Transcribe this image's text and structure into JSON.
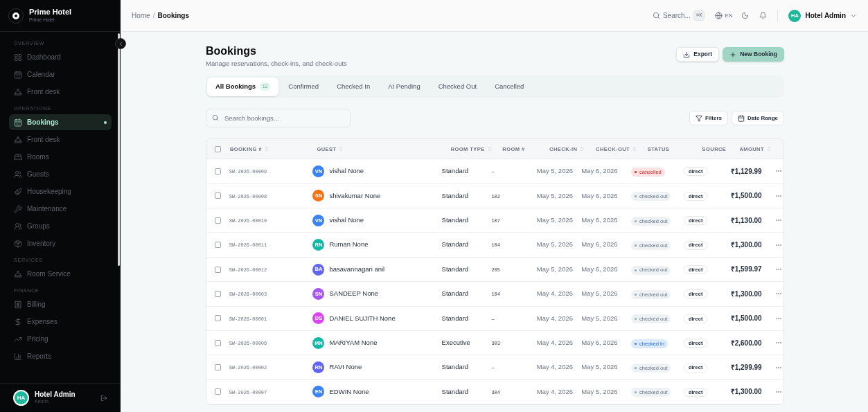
{
  "brand": {
    "name": "Prime Hotel",
    "subtitle": "Prime Hotel"
  },
  "sidebar": {
    "sections": [
      {
        "title": "OVERVIEW",
        "items": [
          {
            "label": "Dashboard",
            "selected": false
          },
          {
            "label": "Calendar",
            "selected": false
          },
          {
            "label": "Front desk",
            "selected": false
          }
        ]
      },
      {
        "title": "OPERATIONS",
        "items": [
          {
            "label": "Bookings",
            "selected": true
          },
          {
            "label": "Front desk",
            "selected": false
          },
          {
            "label": "Rooms",
            "selected": false
          },
          {
            "label": "Guests",
            "selected": false
          },
          {
            "label": "Housekeeping",
            "selected": false
          },
          {
            "label": "Maintenance",
            "selected": false
          },
          {
            "label": "Groups",
            "selected": false
          },
          {
            "label": "Inventory",
            "selected": false
          }
        ]
      },
      {
        "title": "SERVICES",
        "items": [
          {
            "label": "Room Service",
            "selected": false
          }
        ]
      },
      {
        "title": "FINANCE",
        "items": [
          {
            "label": "Billing",
            "selected": false
          },
          {
            "label": "Expenses",
            "selected": false
          },
          {
            "label": "Pricing",
            "selected": false
          },
          {
            "label": "Reports",
            "selected": false
          }
        ]
      }
    ],
    "user": {
      "initials": "HA",
      "name": "Hotel Admin",
      "role": "Admin"
    }
  },
  "breadcrumb": {
    "separator": "/",
    "items": [
      "Home",
      "Bookings"
    ]
  },
  "topbar": {
    "search_placeholder": "Search...",
    "shortcut": "⌘K",
    "language": "EN",
    "user_initials": "HA",
    "user_name": "Hotel Admin"
  },
  "page": {
    "title": "Bookings",
    "subtitle": "Manage reservations, check-ins, and check-outs",
    "buttons": [
      {
        "label": "Export",
        "kind": "export"
      },
      {
        "label": "New Booking",
        "kind": "new"
      }
    ]
  },
  "tabs": [
    {
      "label": "All Bookings",
      "count": "12",
      "selected": true
    },
    {
      "label": "Confirmed",
      "selected": false
    },
    {
      "label": "Checked In",
      "selected": false
    },
    {
      "label": "AI Pending",
      "selected": false
    },
    {
      "label": "Checked Out",
      "selected": false
    },
    {
      "label": "Cancelled",
      "selected": false
    }
  ],
  "search": {
    "placeholder": "Search bookings..."
  },
  "filters": [
    {
      "label": "Filters",
      "kind": "filter"
    },
    {
      "label": "Date Range",
      "kind": "date"
    }
  ],
  "table": {
    "select_all_checked": false,
    "columns": [
      {
        "label": "BOOKING #",
        "sortable": true
      },
      {
        "label": "GUEST",
        "sortable": true
      },
      {
        "label": "ROOM TYPE",
        "sortable": true
      },
      {
        "label": "ROOM #",
        "sortable": false
      },
      {
        "label": "CHECK-IN",
        "sortable": true
      },
      {
        "label": "CHECK-OUT",
        "sortable": true
      },
      {
        "label": "STATUS",
        "sortable": false
      },
      {
        "label": "SOURCE",
        "sortable": false
      },
      {
        "label": "AMOUNT",
        "sortable": true
      }
    ],
    "rows": [
      {
        "checked": false,
        "booking": "SW-2026-00009",
        "initials": "VN",
        "color": "#3b82f6",
        "guest": "vishal None",
        "room_type": "Standard",
        "room": "—",
        "check_in": "May 5, 2026",
        "check_out": "May 6, 2026",
        "status": {
          "label": "cancelled",
          "kind": "cancelled"
        },
        "source": "direct",
        "amount": "₹1,129.99"
      },
      {
        "checked": false,
        "booking": "SW-2026-00008",
        "initials": "SN",
        "color": "#f97316",
        "guest": "shivakumar None",
        "room_type": "Standard",
        "room": "102",
        "check_in": "May 5, 2026",
        "check_out": "May 6, 2026",
        "status": {
          "label": "checked out",
          "kind": "checked_out"
        },
        "source": "direct",
        "amount": "₹1,500.00"
      },
      {
        "checked": false,
        "booking": "SW-2026-00010",
        "initials": "VN",
        "color": "#3b82f6",
        "guest": "vishal None",
        "room_type": "Standard",
        "room": "107",
        "check_in": "May 5, 2026",
        "check_out": "May 6, 2026",
        "status": {
          "label": "checked out",
          "kind": "checked_out"
        },
        "source": "direct",
        "amount": "₹1,130.00"
      },
      {
        "checked": false,
        "booking": "SW-2026-00011",
        "initials": "RN",
        "color": "#14b8a6",
        "guest": "Ruman None",
        "room_type": "Standard",
        "room": "104",
        "check_in": "May 5, 2026",
        "check_out": "May 6, 2026",
        "status": {
          "label": "checked out",
          "kind": "checked_out"
        },
        "source": "direct",
        "amount": "₹1,300.00"
      },
      {
        "checked": false,
        "booking": "SW-2026-00012",
        "initials": "BA",
        "color": "#6366f1",
        "guest": "basavannagari anil",
        "room_type": "Standard",
        "room": "205",
        "check_in": "May 5, 2026",
        "check_out": "May 6, 2026",
        "status": {
          "label": "checked out",
          "kind": "checked_out"
        },
        "source": "direct",
        "amount": "₹1,599.97"
      },
      {
        "checked": false,
        "booking": "SW-2026-00003",
        "initials": "SN",
        "color": "#a855f7",
        "guest": "SANDEEP None",
        "room_type": "Standard",
        "room": "104",
        "check_in": "May 4, 2026",
        "check_out": "May 5, 2026",
        "status": {
          "label": "checked out",
          "kind": "checked_out"
        },
        "source": "direct",
        "amount": "₹1,300.00"
      },
      {
        "checked": false,
        "booking": "SW-2026-00001",
        "initials": "DS",
        "color": "#d946ef",
        "guest": "DANIEL SUJITH None",
        "room_type": "Standard",
        "room": "—",
        "check_in": "May 4, 2026",
        "check_out": "May 5, 2026",
        "status": {
          "label": "checked out",
          "kind": "checked_out"
        },
        "source": "direct",
        "amount": "₹1,500.00"
      },
      {
        "checked": false,
        "booking": "SW-2026-00006",
        "initials": "MN",
        "color": "#14b8a6",
        "guest": "MARIYAM None",
        "room_type": "Executive",
        "room": "303",
        "check_in": "May 4, 2026",
        "check_out": "May 6, 2026",
        "status": {
          "label": "checked in",
          "kind": "checked_in"
        },
        "source": "direct",
        "amount": "₹2,600.00"
      },
      {
        "checked": false,
        "booking": "SW-2026-00002",
        "initials": "RN",
        "color": "#6366f1",
        "guest": "RAVI None",
        "room_type": "Standard",
        "room": "—",
        "check_in": "May 4, 2026",
        "check_out": "May 5, 2026",
        "status": {
          "label": "checked out",
          "kind": "checked_out"
        },
        "source": "direct",
        "amount": "₹1,299.99"
      },
      {
        "checked": false,
        "booking": "SW-2026-00007",
        "initials": "EN",
        "color": "#3b82f6",
        "guest": "EDWIN None",
        "room_type": "Standard",
        "room": "304",
        "check_in": "May 4, 2026",
        "check_out": "May 5, 2026",
        "status": {
          "label": "checked out",
          "kind": "checked_out"
        },
        "source": "direct",
        "amount": "₹1,300.00"
      }
    ]
  }
}
